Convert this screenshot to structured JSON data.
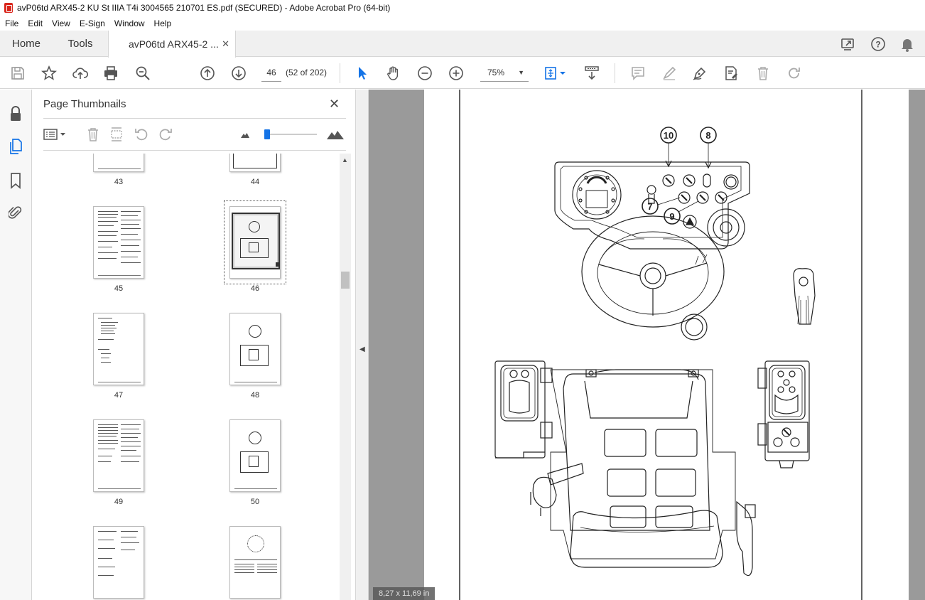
{
  "window": {
    "title": "avP06td ARX45-2 KU St IIIA T4i 3004565 210701 ES.pdf (SECURED) - Adobe Acrobat Pro (64-bit)"
  },
  "menu": [
    "File",
    "Edit",
    "View",
    "E-Sign",
    "Window",
    "Help"
  ],
  "tabs": {
    "home": "Home",
    "tools": "Tools",
    "doc": "avP06td ARX45-2 ...",
    "close": "✕"
  },
  "toolbar": {
    "page_input": "46",
    "page_count": "(52 of 202)",
    "zoom": "75%"
  },
  "panel": {
    "title": "Page Thumbnails",
    "close": "✕",
    "thumbnails": [
      {
        "label": "43"
      },
      {
        "label": "44"
      },
      {
        "label": "45"
      },
      {
        "label": "46",
        "selected": true
      },
      {
        "label": "47"
      },
      {
        "label": "48"
      },
      {
        "label": "49"
      },
      {
        "label": "50"
      },
      {
        "label": ""
      },
      {
        "label": ""
      }
    ]
  },
  "document": {
    "page_size": "8,27 x 11,69 in",
    "callouts": [
      "10",
      "8",
      "7",
      "9"
    ]
  },
  "colors": {
    "accent": "#1473e6",
    "doc_bg": "#9a9a9a",
    "pdf_red": "#d9261c"
  }
}
